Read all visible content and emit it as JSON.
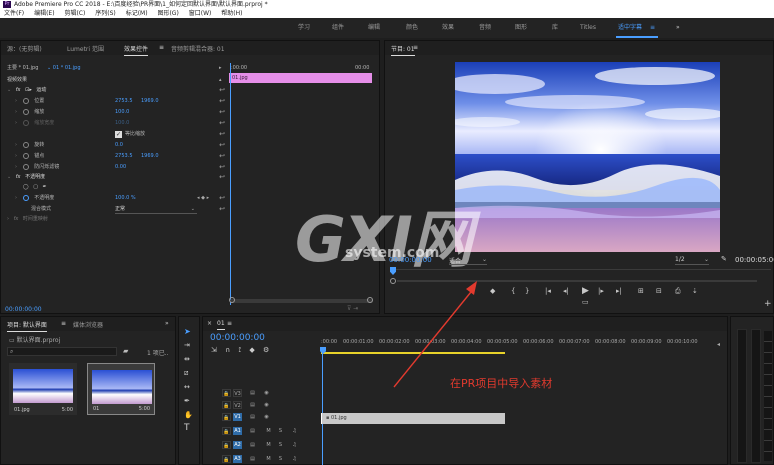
{
  "window": {
    "title": "Adobe Premiere Pro CC 2018 - E:\\百度经验\\PR界面\\1_如何定回默认界面\\默认界面.prproj *",
    "app_icon": "Pr",
    "menu": [
      "文件(F)",
      "编辑(E)",
      "剪辑(C)",
      "序列(S)",
      "标记(M)",
      "图形(G)",
      "窗口(W)",
      "帮助(H)"
    ]
  },
  "workspaces": {
    "items": [
      "学习",
      "组件",
      "编辑",
      "颜色",
      "效果",
      "音频",
      "图形",
      "库",
      "Titles",
      "适中字幕"
    ],
    "active": "适中字幕",
    "active_suffix": "≡",
    "more": "»"
  },
  "left_panel": {
    "tabs": [
      "源：(无剪辑)",
      "Lumetri 范围",
      "效果控件",
      "音频剪辑混合器: 01"
    ],
    "active_tab": "效果控件",
    "menu_glyph": "≡",
    "master_label": "主要 * 01.jpg",
    "clip_label": "01 * 01.jpg",
    "ruler_start": ":00:00",
    "ruler_end": "00:00",
    "clip_bar": "01.jpg",
    "video_fx_heading": "视频效果",
    "motion_fx": "fx",
    "motion_label": "运动",
    "props": [
      {
        "label": "位置",
        "values": [
          "2753.5",
          "1969.0"
        ]
      },
      {
        "label": "缩放",
        "values": [
          "100.0"
        ]
      },
      {
        "label": "缩放宽度",
        "values": [
          "100.0"
        ],
        "disabled": true
      },
      {
        "label": "等比缩放",
        "checkbox": true
      },
      {
        "label": "旋转",
        "values": [
          "0.0"
        ]
      },
      {
        "label": "锚点",
        "values": [
          "2753.5",
          "1969.0"
        ]
      },
      {
        "label": "防闪烁滤镜",
        "values": [
          "0.00"
        ]
      }
    ],
    "opacity_label": "不透明度",
    "opacity_value_label": "不透明度",
    "opacity_value": "100.0 %",
    "blend_label": "混合模式",
    "blend_value": "正常",
    "time_remap_label": "时间重映射",
    "timecode": "00:00:00:00"
  },
  "program": {
    "title": "节目: 01",
    "menu_glyph": "≡",
    "timecode": "00:00:00:00",
    "fit": "适合",
    "ratio": "1/2",
    "duration": "00:00:05:00",
    "more": "»"
  },
  "project": {
    "tabs": [
      "项目: 默认界面",
      "媒体浏览器"
    ],
    "active_tab": "项目: 默认界面",
    "menu_glyph": "≡",
    "more": "»",
    "file_name": "默认界面.prproj",
    "search_placeholder": "",
    "item_count": "1 项已..",
    "items": [
      {
        "name": "01.jpg",
        "duration": "5:00"
      },
      {
        "name": "01",
        "duration": "5:00"
      }
    ]
  },
  "timeline": {
    "seq_close": "×",
    "seq_name": "01",
    "menu_glyph": "≡",
    "timecode": "00:00:00:00",
    "ruler": [
      ":00:00",
      "00:00:01:00",
      "00:00:02:00",
      "00:00:03:00",
      "00:00:04:00",
      "00:00:05:00",
      "00:00:06:00",
      "00:00:07:00",
      "00:00:08:00",
      "00:00:09:00",
      "00:00:10:00"
    ],
    "video_tracks": [
      "V3",
      "V2",
      "V1"
    ],
    "audio_tracks": [
      "A1",
      "A2",
      "A3"
    ],
    "clip": "01.jpg",
    "annotation": "在PR项目中导入素材"
  },
  "watermark": {
    "big": "GXI网",
    "small": "system.com"
  },
  "icon_glyphs": {
    "marker": "◆",
    "mark_in": "{",
    "mark_out": "}",
    "go_in": "|◂",
    "step_back": "◂|",
    "play": "▶",
    "step_fwd": "|▸",
    "go_out": "▸|",
    "insert": "⊞",
    "overwrite": "⊟",
    "lift": "⇡",
    "extract": "⇣",
    "camera": "⎙",
    "compare": "▭",
    "wrench": "🔧",
    "reset": "↩",
    "keyframe_prev": "◂",
    "keyframe_add": "◆",
    "keyframe_next": "▸",
    "eye": "👁",
    "film": "▤",
    "lock": "🔒",
    "mic": "🎤",
    "gear": "⚙"
  },
  "colors": {
    "accent": "#4a9eff",
    "clip_pink": "#e58ee8",
    "annotation": "#e23a2e",
    "track_blue": "#2f6ca8",
    "work_area": "#e8d22a"
  }
}
